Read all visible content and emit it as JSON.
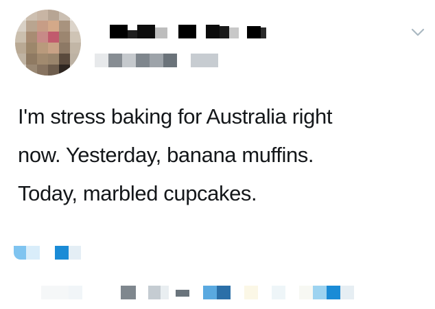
{
  "tweet": {
    "text_lines": [
      "I'm stress baking for Australia right",
      "now. Yesterday, banana muffins.",
      "Today, marbled cupcakes."
    ]
  },
  "icons": {
    "menu": "chevron-down-icon"
  },
  "colors": {
    "text": "#14171a",
    "chevron": "#aab8c2",
    "link_blue": "#1da1f2"
  }
}
